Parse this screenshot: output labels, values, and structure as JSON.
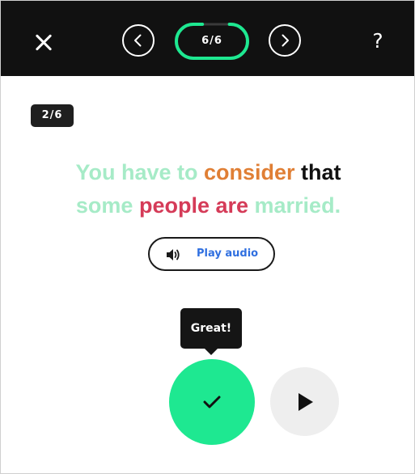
{
  "header": {
    "close_icon": "close-icon",
    "prev_icon": "chevron-left-icon",
    "next_icon": "chevron-right-icon",
    "progress": {
      "label": "6/6",
      "fraction": 0.85
    },
    "help_label": "?"
  },
  "exercise": {
    "counter": "2/6",
    "sentence_line1": [
      {
        "text": "You have to ",
        "color": "#a6ebc7"
      },
      {
        "text": "consider",
        "color": "#e07f35"
      },
      {
        "text": " that",
        "color": "#111111"
      }
    ],
    "sentence_line2": [
      {
        "text": "some ",
        "color": "#a6ebc7"
      },
      {
        "text": "people are",
        "color": "#d53b58"
      },
      {
        "text": " married.",
        "color": "#a6ebc7"
      }
    ],
    "audio": {
      "label": "Play audio",
      "icon": "speaker-icon"
    }
  },
  "feedback": {
    "tooltip": "Great!",
    "check_icon": "checkmark-icon",
    "play_icon": "play-icon"
  },
  "colors": {
    "topbar": "#111111",
    "accent_green": "#1ee891",
    "link_blue": "#2f6fe0",
    "play_bg": "#eeeeee"
  }
}
